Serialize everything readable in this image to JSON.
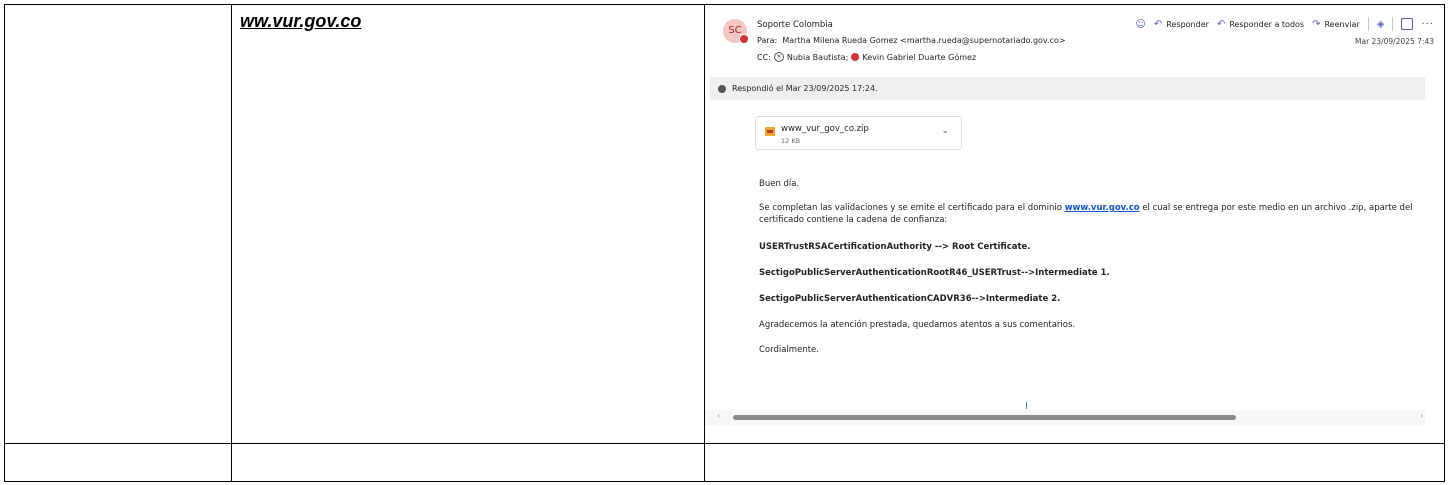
{
  "row1": {
    "domain_title": "ww.vur.gov.co"
  },
  "email": {
    "avatar_initials": "SC",
    "sender": "Soporte Colombia",
    "to_label": "Para:",
    "to_value": "Martha Milena Rueda Gomez <martha.rueda@supernotariado.gov.co>",
    "cc_label": "CC:",
    "cc_person1": "Nubia Bautista;",
    "cc_person2": "Kevin Gabriel Duarte Gómez",
    "date": "Mar 23/09/2025 7:43",
    "actions": {
      "reply": "Responder",
      "reply_all": "Responder a todos",
      "forward": "Reenviar"
    },
    "replied_notice": "Respondió el Mar 23/09/2025 17:24.",
    "attachment": {
      "name": "www_vur_gov_co.zip",
      "size": "12 KB"
    },
    "body": {
      "greeting": "Buen día.",
      "p1_before": "Se completan las validaciones y se emite el certificado para el dominio ",
      "p1_link": "www.vur.gov.co",
      "p1_after": " el cual se entrega por este medio en un archivo .zip, aparte del certificado contiene la cadena de confianza:",
      "chain1": "USERTrustRSACertificationAuthority --> Root Certificate.",
      "chain2": "SectigoPublicServerAuthenticationRootR46_USERTrust-->Intermediate 1.",
      "chain3": "SectigoPublicServerAuthenticationCADVR36-->Intermediate 2.",
      "thanks": "Agradecemos la atención prestada, quedamos atentos a sus comentarios.",
      "closing": "Cordialmente."
    }
  },
  "icons": {
    "emoji": "smile-icon",
    "reply": "reply-icon",
    "reply_all": "reply-all-icon",
    "forward": "forward-icon",
    "copilot": "copilot-icon",
    "grid": "grid-icon",
    "more": "more-icon",
    "info": "info-icon",
    "zip": "zip-file-icon",
    "chevron": "chevron-down-icon"
  },
  "colors": {
    "accent": "#5b5fc7",
    "link": "#0f55c9",
    "status_red": "#d13438"
  }
}
